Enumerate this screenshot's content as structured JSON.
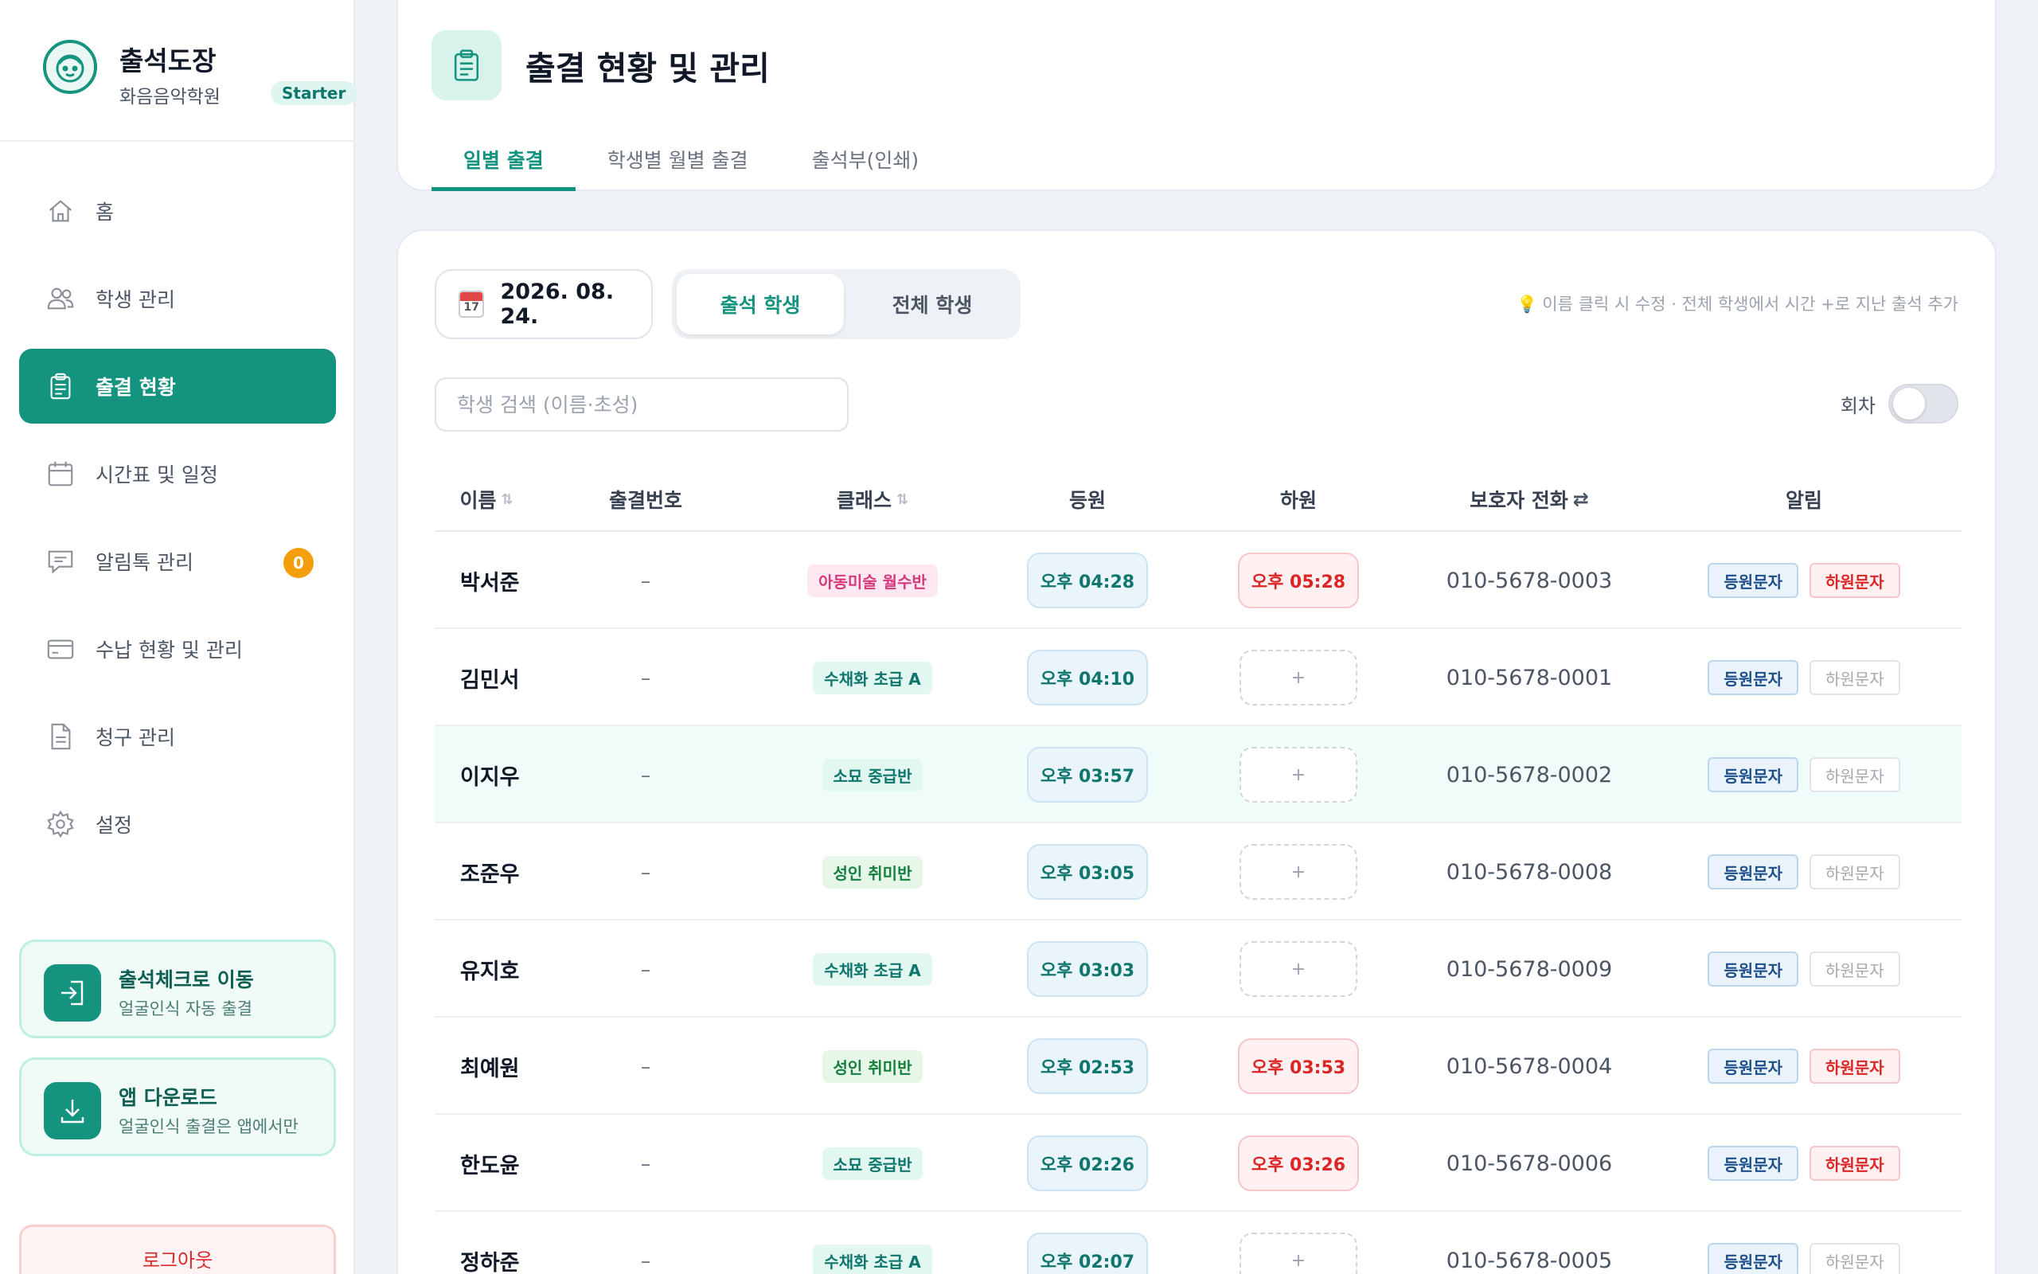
{
  "brand": {
    "name": "출석도장",
    "academy": "화음음악학원",
    "plan": "Starter"
  },
  "nav": {
    "items": [
      {
        "label": "홈",
        "icon": "home-icon",
        "active": false
      },
      {
        "label": "학생 관리",
        "icon": "users-icon",
        "active": false
      },
      {
        "label": "출결 현황",
        "icon": "clipboard-icon",
        "active": true
      },
      {
        "label": "시간표 및 일정",
        "icon": "calendar-icon",
        "active": false
      },
      {
        "label": "알림톡 관리",
        "icon": "chat-icon",
        "active": false,
        "badge": "0"
      },
      {
        "label": "수납 현황 및 관리",
        "icon": "card-icon",
        "active": false
      },
      {
        "label": "청구 관리",
        "icon": "document-icon",
        "active": false
      },
      {
        "label": "설정",
        "icon": "gear-icon",
        "active": false
      }
    ]
  },
  "promos": [
    {
      "title": "출석체크로 이동",
      "subtitle": "얼굴인식 자동 출결",
      "icon": "login-icon"
    },
    {
      "title": "앱 다운로드",
      "subtitle": "얼굴인식 출결은 앱에서만",
      "icon": "download-icon"
    }
  ],
  "logout_label": "로그아웃",
  "header": {
    "title": "출결 현황 및 관리",
    "tabs": [
      "일별 출결",
      "학생별 월별 출결",
      "출석부(인쇄)"
    ],
    "active_tab": 0
  },
  "toolbar": {
    "date": "2026. 08. 24.",
    "calendar_day": "17",
    "segments": [
      "출석 학생",
      "전체 학생"
    ],
    "active_segment": 0,
    "hint": "이름 클릭 시 수정 · 전체 학생에서 시간 +로 지난 출석 추가",
    "search_placeholder": "학생 검색 (이름·초성)",
    "round_label": "회차",
    "round_toggle_on": false
  },
  "table": {
    "columns": {
      "name": "이름",
      "number": "출결번호",
      "class": "클래스",
      "checkin": "등원",
      "checkout": "하원",
      "phone": "보호자 전화",
      "alert": "알림"
    },
    "sort_glyph": "⇅",
    "swap_glyph": "⇄",
    "msg_in_label": "등원문자",
    "msg_out_label": "하원문자",
    "add_glyph": "+",
    "rows": [
      {
        "name": "박서준",
        "number": "–",
        "class": "아동미술 월수반",
        "class_color": "pink",
        "checkin": "오후 04:28",
        "checkout": "오후 05:28",
        "phone": "010-5678-0003",
        "highlight": false
      },
      {
        "name": "김민서",
        "number": "–",
        "class": "수채화 초급 A",
        "class_color": "teal",
        "checkin": "오후 04:10",
        "checkout": "",
        "phone": "010-5678-0001",
        "highlight": false
      },
      {
        "name": "이지우",
        "number": "–",
        "class": "소묘 중급반",
        "class_color": "teal",
        "checkin": "오후 03:57",
        "checkout": "",
        "phone": "010-5678-0002",
        "highlight": true
      },
      {
        "name": "조준우",
        "number": "–",
        "class": "성인 취미반",
        "class_color": "green",
        "checkin": "오후 03:05",
        "checkout": "",
        "phone": "010-5678-0008",
        "highlight": false
      },
      {
        "name": "유지호",
        "number": "–",
        "class": "수채화 초급 A",
        "class_color": "teal",
        "checkin": "오후 03:03",
        "checkout": "",
        "phone": "010-5678-0009",
        "highlight": false
      },
      {
        "name": "최예원",
        "number": "–",
        "class": "성인 취미반",
        "class_color": "green",
        "checkin": "오후 02:53",
        "checkout": "오후 03:53",
        "phone": "010-5678-0004",
        "highlight": false
      },
      {
        "name": "한도윤",
        "number": "–",
        "class": "소묘 중급반",
        "class_color": "teal",
        "checkin": "오후 02:26",
        "checkout": "오후 03:26",
        "phone": "010-5678-0006",
        "highlight": false
      },
      {
        "name": "정하준",
        "number": "–",
        "class": "수채화 초급 A",
        "class_color": "teal",
        "checkin": "오후 02:07",
        "checkout": "",
        "phone": "010-5678-0005",
        "highlight": false
      }
    ]
  },
  "colors": {
    "accent": "#14937f",
    "checkout_red": "#dc2626",
    "badge_orange": "#f59e0b"
  }
}
